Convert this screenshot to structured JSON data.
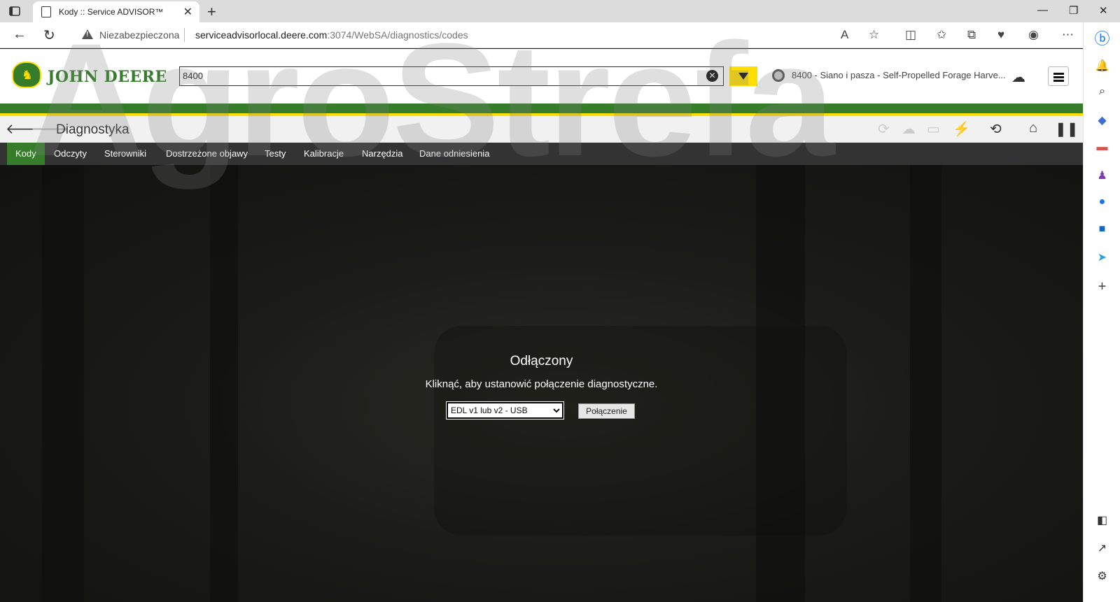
{
  "browser": {
    "tab_title": "Kody :: Service ADVISOR™",
    "new_tab": "+",
    "insecure_label": "Niezabezpieczona",
    "url_host": "serviceadvisorlocal.deere.com",
    "url_path": ":3074/WebSA/diagnostics/codes",
    "minimize": "—",
    "restore": "❐",
    "close": "✕"
  },
  "header": {
    "brand": "JOHN DEERE",
    "search_value": "8400",
    "machine_label": "8400 - Siano i pasza - Self-Propelled Forage Harve..."
  },
  "subheader": {
    "title": "Diagnostyka"
  },
  "nav": {
    "items": [
      {
        "label": "Kody"
      },
      {
        "label": "Odczyty"
      },
      {
        "label": "Sterowniki"
      },
      {
        "label": "Dostrzeżone objawy"
      },
      {
        "label": "Testy"
      },
      {
        "label": "Kalibracje"
      },
      {
        "label": "Narzędzia"
      },
      {
        "label": "Dane odniesienia"
      }
    ],
    "active_index": 0
  },
  "main": {
    "status_title": "Odłączony",
    "status_message": "Kliknąć, aby ustanowić połączenie diagnostyczne.",
    "connection_selected": "EDL v1 lub v2 - USB",
    "connect_button": "Połączenie"
  },
  "watermark": "AgroStrefa",
  "colors": {
    "brand_green": "#367c2b",
    "brand_yellow": "#ffde00",
    "nav_bg": "#333333"
  }
}
